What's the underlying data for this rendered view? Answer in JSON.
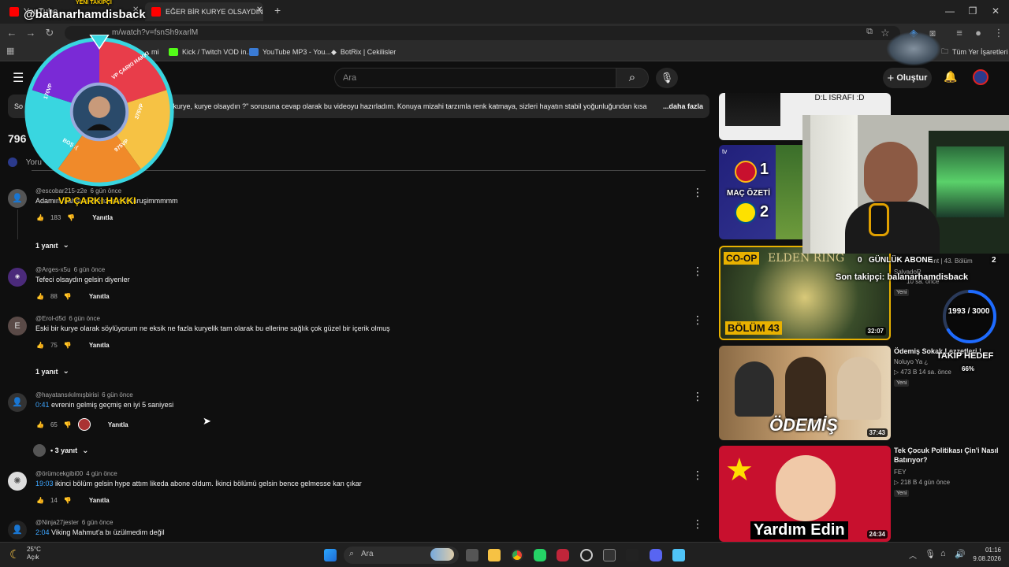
{
  "browser": {
    "tabs": [
      {
        "label": "YouTube"
      },
      {
        "label": "EĞER BİR KURYE OLSAYDIN"
      }
    ],
    "url": "m/watch?v=fsnSh9xarlM",
    "bookmarks": [
      "mi",
      "Kick / Twitch VOD in...",
      "YouTube MP3 - You...",
      "BotRix | Cekilisler"
    ],
    "bookmarks_right": "Tüm Yer İşaretleri"
  },
  "youtube": {
    "search_placeholder": "Ara",
    "create_label": "Oluştur",
    "description": "kurye, kurye olsaydın ?\" sorusuna cevap olarak bu videoyu hazırladım. Konuya mizahi tarzımla renk katmaya, sizleri hayatın stabil yoğunluğundan kısa",
    "description_prefix": "So",
    "description_more": "...daha fazla",
    "comment_count": "796",
    "add_comment_placeholder": "Yoru",
    "reply_label": "Yanıtla",
    "comments": [
      {
        "author": "@escobar215-z2e",
        "time": "6 gün önce",
        "text": "Adamın mahsuna benzemesi karuşimmmmm",
        "likes": "183",
        "replies": "1 yanıt"
      },
      {
        "author": "@Arges-x5u",
        "time": "6 gün önce",
        "text": "Tefeci olsaydın gelsin diyenler",
        "likes": "88"
      },
      {
        "author": "@Erol-d5d",
        "time": "6 gün önce",
        "text": "Eski bir kurye olarak söylüyorum ne eksik ne fazla kuryelik tam olarak bu ellerine sağlık çok güzel bir içerik olmuş",
        "likes": "75",
        "replies": "1 yanıt",
        "avatar_letter": "E"
      },
      {
        "author": "@hayatansıkılmışbirisi",
        "time": "6 gün önce",
        "timestamp": "0:41",
        "text": "evrenin gelmiş geçmiş en iyi 5 saniyesi",
        "likes": "65",
        "replies": "• 3 yanıt"
      },
      {
        "author": "@örümcekgibi00",
        "time": "4 gün önce",
        "timestamp": "19:03",
        "text": "ikinci bölüm gelsin hype attım likeda abone oldum. İkinci bölümü gelsin bence gelmesse kan çıkar",
        "likes": "14"
      },
      {
        "author": "@Ninja27jester",
        "time": "6 gün önce",
        "timestamp": "2:04",
        "text": "Viking Mahmut'a bı üzülmedim değil"
      }
    ],
    "sidebar": [
      {
        "thumb_text": "D:L ISRAFI :D"
      },
      {
        "thumb_text": "MAÇ ÖZETİ",
        "score_home": "1",
        "score_away": "2"
      },
      {
        "thumb_text": "CO-OP",
        "thumb_text2": "ELDEN RING",
        "thumb_text3": "BÖLÜM 43",
        "duration": "32:07",
        "title": "ent | 43. Bölüm",
        "channel": "SalvadoR",
        "meta": "10 sa. önce",
        "badge": "Yeni"
      },
      {
        "thumb_text": "ÖDEMİŞ",
        "duration": "37:43",
        "title": "Ödemiş Sokak Lezzetleri !",
        "channel": "Noluyo Ya ¿",
        "meta": "▷ 473 B  14 sa. önce",
        "badge": "Yeni"
      },
      {
        "thumb_text": "Yardım Edin",
        "duration": "24:34",
        "title": "Tek Çocuk Politikası Çin'i Nasıl Batırıyor?",
        "channel": "FEY",
        "meta": "▷ 218 B  4 gün önce",
        "badge": "Yeni"
      }
    ]
  },
  "overlay": {
    "channel_name": "@balanarhamdisback",
    "new_follower_label": "YENİ TAKİPÇİ",
    "wheel_segments": [
      "VP ÇARKI HAKKI",
      "375VP",
      "975VP",
      "BOŞ :(",
      "170VP"
    ],
    "wheel_caption": "VP ÇARKI HAKKI",
    "daily_subs_label": "GÜNLÜK ABONE",
    "daily_subs_left": "0",
    "daily_subs_right": "2",
    "last_follower": "Son takipçi: balanarhamdisback",
    "follow_goal": "1993 / 3000",
    "follow_goal_label": "TAKİP HEDEF",
    "follow_goal_fraction": 0.66,
    "follow_goal_percent": "66%"
  },
  "taskbar": {
    "weather_temp": "25°C",
    "weather_desc": "Açık",
    "search_label": "Ara",
    "time": "01:16",
    "date": "9.08.2026"
  }
}
